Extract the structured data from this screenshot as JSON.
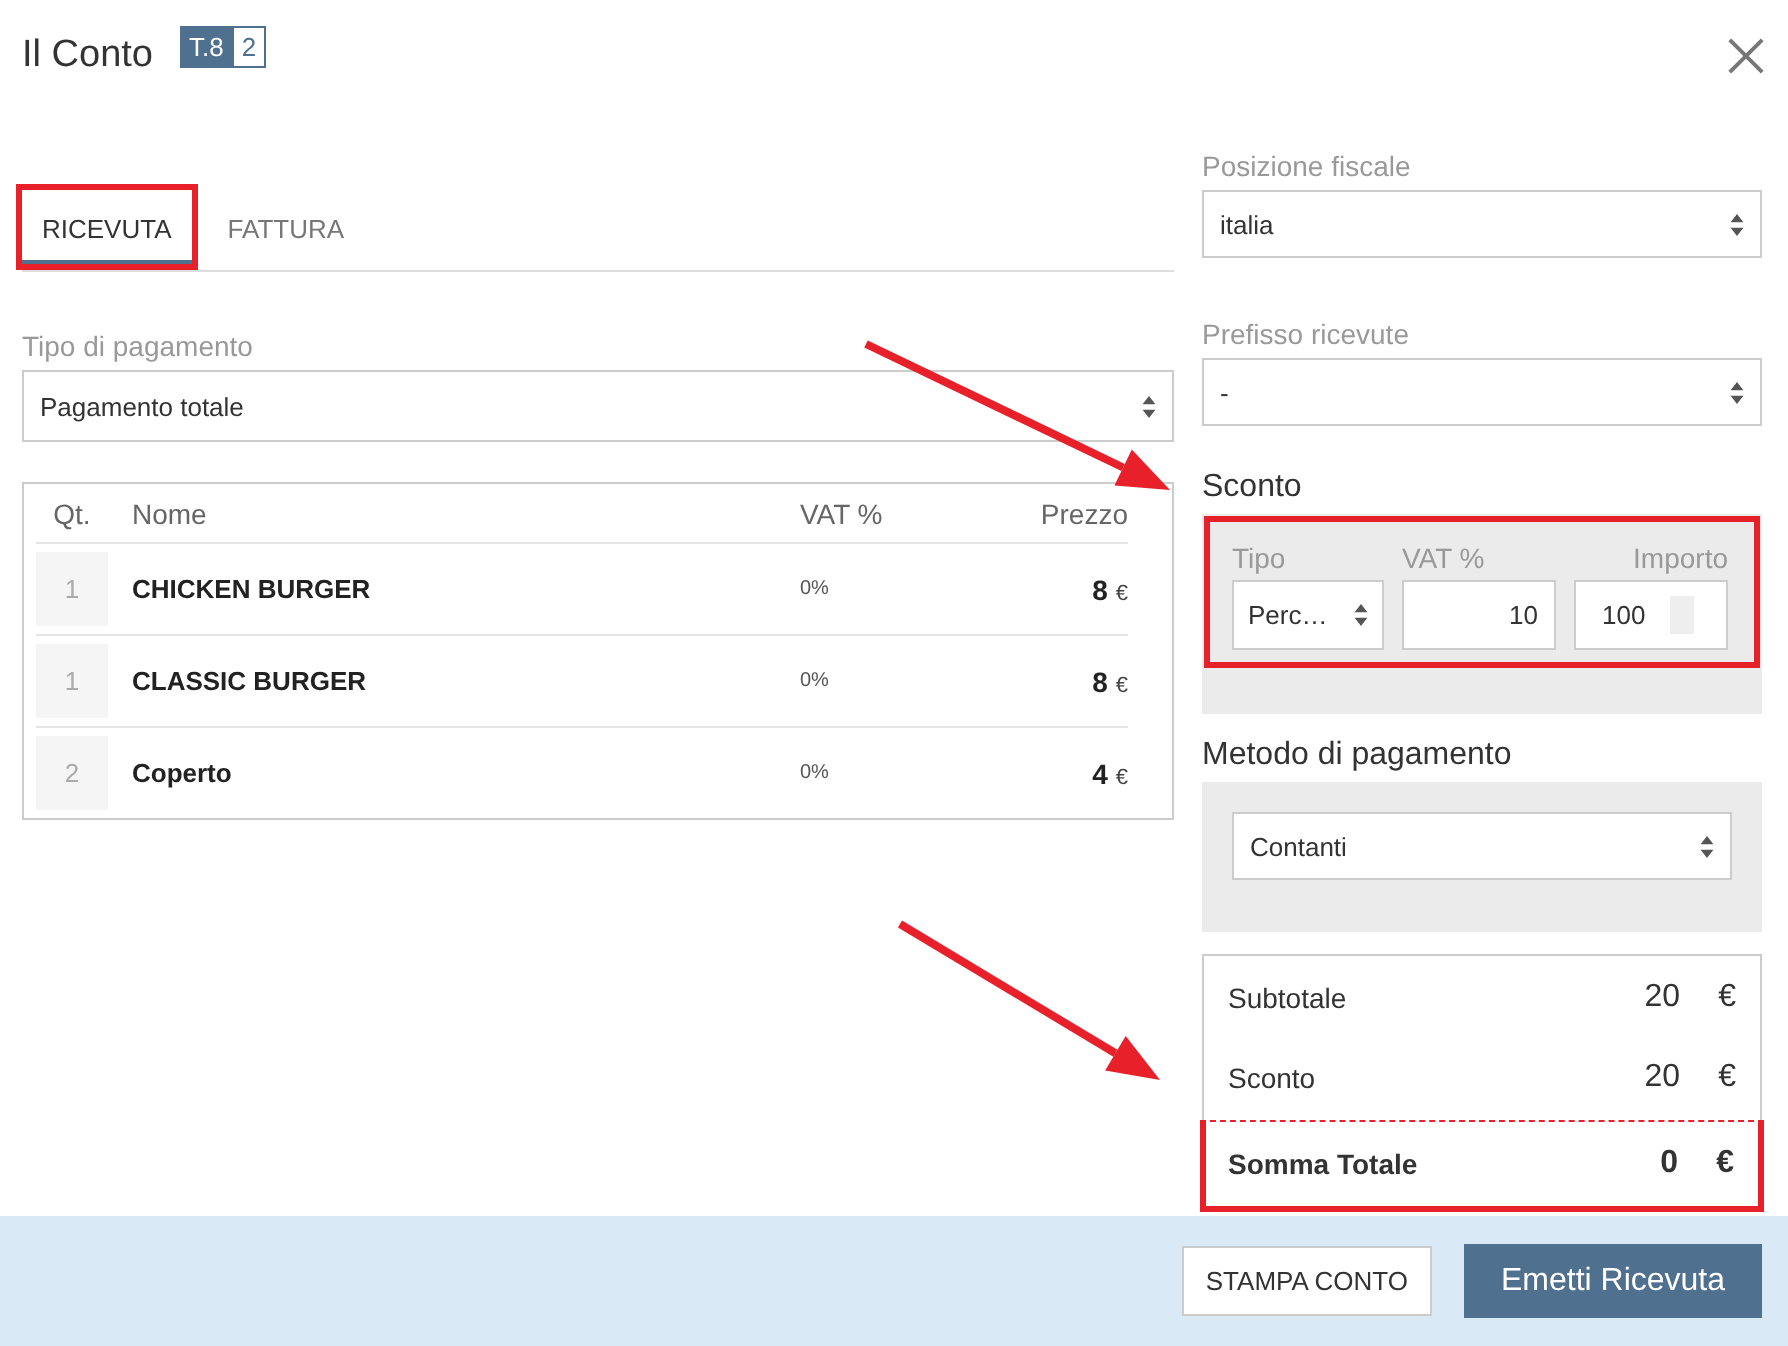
{
  "window": {
    "title": "Il Conto",
    "table_badge": "T.8",
    "guests_badge": "2"
  },
  "tabs": [
    {
      "label": "RICEVUTA",
      "selected": true,
      "highlighted": true
    },
    {
      "label": "FATTURA",
      "selected": false,
      "highlighted": false
    }
  ],
  "payment_type": {
    "label": "Tipo di pagamento",
    "value": "Pagamento totale"
  },
  "items": {
    "columns": [
      "Qt.",
      "Nome",
      "VAT %",
      "Prezzo"
    ],
    "rows": [
      {
        "qty": "1",
        "name": "CHICKEN BURGER",
        "vat": "0%",
        "price": "8",
        "currency": "€"
      },
      {
        "qty": "1",
        "name": "CLASSIC BURGER",
        "vat": "0%",
        "price": "8",
        "currency": "€"
      },
      {
        "qty": "2",
        "name": "Coperto",
        "vat": "0%",
        "price": "4",
        "currency": "€"
      }
    ]
  },
  "fiscal_position": {
    "label": "Posizione fiscale",
    "value": "italia"
  },
  "receipt_prefix": {
    "label": "Prefisso ricevute",
    "value": "-"
  },
  "discount": {
    "title": "Sconto",
    "highlighted": true,
    "type": {
      "label": "Tipo",
      "value": "Perc…"
    },
    "vat": {
      "label": "VAT %",
      "value": "10"
    },
    "amount": {
      "label": "Importo",
      "value": "100"
    }
  },
  "payment_method": {
    "title": "Metodo di pagamento",
    "value": "Contanti"
  },
  "totals": {
    "rows": [
      {
        "label": "Subtotale",
        "value": "20",
        "currency": "€"
      },
      {
        "label": "Sconto",
        "value": "20",
        "currency": "€"
      }
    ],
    "grand_total": {
      "label": "Somma Totale",
      "value": "0",
      "currency": "€",
      "highlighted": true
    }
  },
  "annotations": [
    {
      "kind": "arrow"
    },
    {
      "kind": "arrow"
    }
  ],
  "buttons": [
    {
      "label": "STAMPA CONTO",
      "kind": "secondary"
    },
    {
      "label": "Emetti Ricevuta",
      "kind": "primary"
    }
  ]
}
